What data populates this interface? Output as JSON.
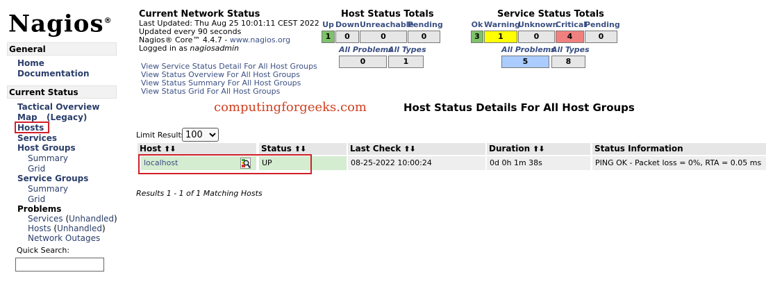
{
  "brand": {
    "logo_text": "Nagios",
    "logo_mark": "®"
  },
  "sidebar": {
    "general_label": "General",
    "home": "Home",
    "documentation": "Documentation",
    "current_status_label": "Current Status",
    "tactical_overview": "Tactical Overview",
    "map": "Map",
    "legacy": "(Legacy)",
    "hosts": "Hosts",
    "services": "Services",
    "host_groups": "Host Groups",
    "hg_summary": "Summary",
    "hg_grid": "Grid",
    "service_groups": "Service Groups",
    "sg_summary": "Summary",
    "sg_grid": "Grid",
    "problems": "Problems",
    "prob_services": "Services",
    "prob_hosts": "Hosts",
    "unhandled_1": "Unhandled",
    "unhandled_2": "Unhandled",
    "network_outages": "Network Outages",
    "quick_search_label": "Quick Search:",
    "quick_search_value": ""
  },
  "info": {
    "title": "Current Network Status",
    "last_updated": "Last Updated: Thu Aug 25 10:01:11 CEST 2022",
    "update_interval": "Updated every 90 seconds",
    "core_prefix": "Nagios® Core™ 4.4.7 - ",
    "core_link": "www.nagios.org",
    "logged_prefix": "Logged in as ",
    "user": "nagiosadmin",
    "links": [
      "View Service Status Detail For All Host Groups",
      "View Status Overview For All Host Groups",
      "View Status Summary For All Host Groups",
      "View Status Grid For All Host Groups"
    ]
  },
  "host_totals": {
    "title": "Host Status Totals",
    "headers": [
      "Up",
      "Down",
      "Unreachable",
      "Pending"
    ],
    "values": [
      "1",
      "0",
      "0",
      "0"
    ],
    "problems_label": "All Problems",
    "types_label": "All Types",
    "problems_value": "0",
    "types_value": "1"
  },
  "service_totals": {
    "title": "Service Status Totals",
    "headers": [
      "Ok",
      "Warning",
      "Unknown",
      "Critical",
      "Pending"
    ],
    "values": [
      "3",
      "1",
      "0",
      "4",
      "0"
    ],
    "problems_label": "All Problems",
    "types_label": "All Types",
    "problems_value": "5",
    "types_value": "8"
  },
  "colors": {
    "up": "#7ec26a",
    "ok": "#7ec26a",
    "warning": "#ffff00",
    "critical": "#f08080",
    "problems_highlight": "#aaccff",
    "row_green": "#d4ecd0",
    "highlight_border": "#d0202a"
  },
  "watermark": "computingforgeeks.com",
  "details_title": "Host Status Details For All Host Groups",
  "limit": {
    "label": "Limit Results:",
    "value": "100"
  },
  "table": {
    "headers": [
      "Host",
      "Status",
      "Last Check",
      "Duration",
      "Status Information"
    ],
    "row": {
      "host": "localhost",
      "status": "UP",
      "last_check": "08-25-2022 10:00:24",
      "duration": "0d 0h 1m 38s",
      "info": "PING OK - Packet loss = 0%, RTA = 0.05 ms"
    }
  },
  "results_text": "Results 1 - 1 of 1 Matching Hosts"
}
